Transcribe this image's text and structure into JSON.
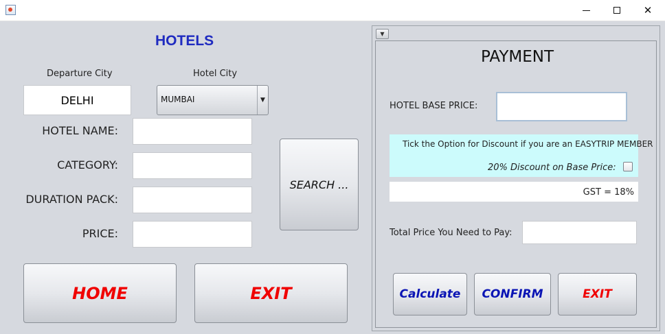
{
  "window": {
    "icon": "java-app-icon",
    "controls": {
      "minimize": "minimize-icon",
      "maximize": "maximize-icon",
      "close_glyph": "✕"
    }
  },
  "hotels": {
    "title": "HOTELS",
    "departure_city_label": "Departure City",
    "departure_city_value": "DELHI",
    "hotel_city_label": "Hotel City",
    "hotel_city_value": "MUMBAI",
    "hotel_name_label": "HOTEL NAME:",
    "category_label": "CATEGORY:",
    "duration_label": "DURATION PACK:",
    "price_label": "PRICE:",
    "hotel_name_value": "",
    "category_value": "",
    "duration_value": "",
    "price_value": "",
    "search_button": "SEARCH ...",
    "home_button": "HOME",
    "exit_button": "EXIT"
  },
  "payment": {
    "title": "PAYMENT",
    "base_price_label": "HOTEL BASE PRICE:",
    "base_price_value": "",
    "discount_note": "Tick the Option for Discount if you are an EASYTRIP MEMBER",
    "discount_label": "20% Discount on Base Price:",
    "discount_checked": false,
    "gst_text": "GST = 18%",
    "total_label": "Total Price You Need to Pay:",
    "total_value": "",
    "calculate_button": "Calculate",
    "confirm_button": "CONFIRM",
    "exit_button": "EXIT"
  },
  "colors": {
    "title_blue": "#1f2bc0",
    "red_text": "#f00000",
    "blue_text": "#0a14b4",
    "cyan_panel": "#ccfbfc",
    "background": "#d6d9df"
  }
}
